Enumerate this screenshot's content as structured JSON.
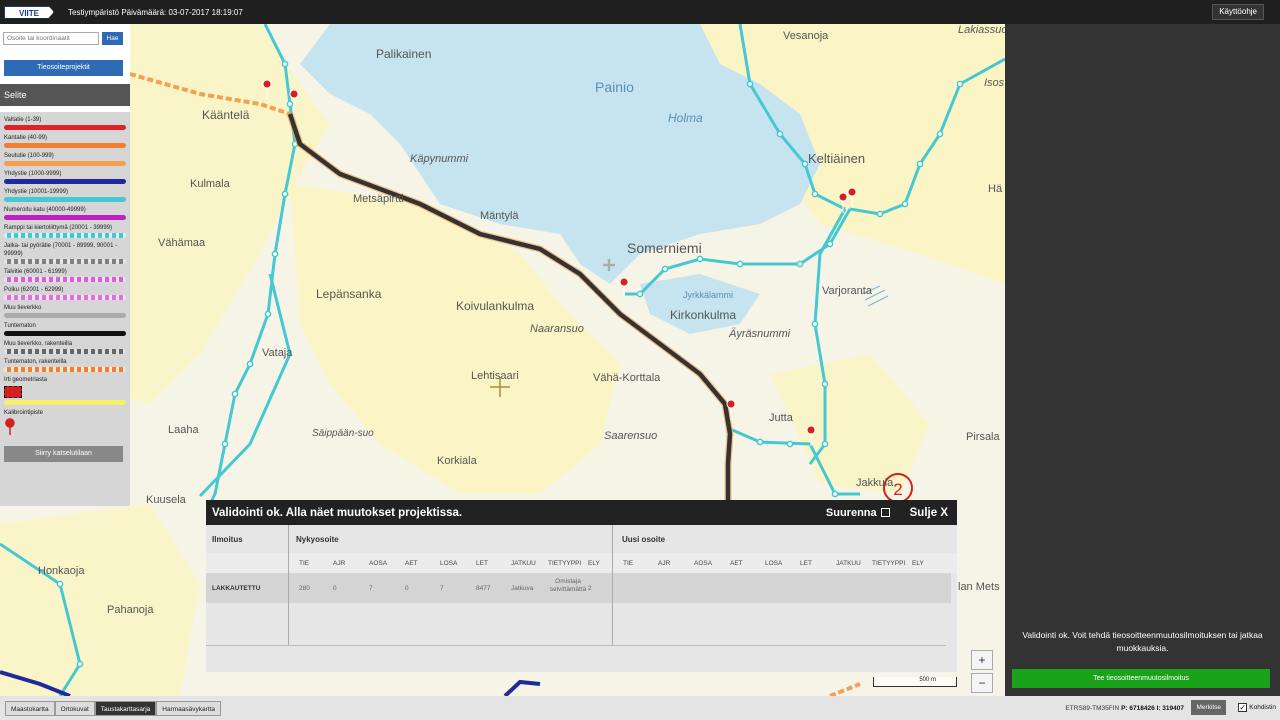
{
  "header": {
    "logo": "VIITE",
    "env": "Testiympäristö Päivämäärä: 03-07-2017 18:19:07",
    "help_label": "Käyttöohje"
  },
  "sidebar": {
    "search_placeholder": "Osoite tai koordinaatit",
    "search_button": "Hae",
    "project_button": "Tieosoiteprojektit",
    "legend_title": "Selite",
    "legend": [
      {
        "label": "Valtatie (1-39)",
        "color": "#e0202a"
      },
      {
        "label": "Kantatie (40-99)",
        "color": "#f08030"
      },
      {
        "label": "Seututie (100-999)",
        "color": "#f4a050"
      },
      {
        "label": "Yhdystie (1000-9999)",
        "color": "#202a9c"
      },
      {
        "label": "Yhdystie (10001-19999)",
        "color": "#45c8d2"
      },
      {
        "label": "Numeroitu katu (40000-49999)",
        "color": "#c020c8"
      },
      {
        "label": "Ramppi tai kiertoliittymä (20001 - 39999)",
        "color": "#45c8d2"
      },
      {
        "label": "Jalka- tai pyörätie (70001 - 89999, 90001 - 99999)",
        "color": "#808080"
      },
      {
        "label": "Talvitie (60001 - 61999)",
        "color": "#d860d8"
      },
      {
        "label": "Polku (62001 - 62999)",
        "color": "#e070e0"
      },
      {
        "label": "Muu tieverkko",
        "color": "#aaaaaa"
      },
      {
        "label": "Tuntematon",
        "color": "#111111"
      },
      {
        "label": "Muu tieverkko, rakenteilla",
        "color": "#666666"
      },
      {
        "label": "Tuntematon, rakenteilla",
        "color": "#f08030"
      }
    ],
    "detached_label": "Irti geometriasta",
    "calibration_label": "Kalibrointipiste",
    "return_button": "Siirry katselutilaan"
  },
  "map": {
    "places": [
      {
        "name": "Palikainen",
        "style": "town"
      },
      {
        "name": "Kääntelä",
        "style": "town"
      },
      {
        "name": "Kulmala",
        "style": "town"
      },
      {
        "name": "Vähämaa",
        "style": "town"
      },
      {
        "name": "Metsäpirtti",
        "style": "town"
      },
      {
        "name": "Käpynummi",
        "style": "italic"
      },
      {
        "name": "Mäntylä",
        "style": "town"
      },
      {
        "name": "Lepänsanka",
        "style": "town"
      },
      {
        "name": "Vataja",
        "style": "town"
      },
      {
        "name": "Koivulankulma",
        "style": "town"
      },
      {
        "name": "Naaransuo",
        "style": "italic"
      },
      {
        "name": "Lehtisaari",
        "style": "town"
      },
      {
        "name": "Vähä-Korttala",
        "style": "town"
      },
      {
        "name": "Laaha",
        "style": "town"
      },
      {
        "name": "Säippään-suo",
        "style": "italic"
      },
      {
        "name": "Korkiala",
        "style": "town"
      },
      {
        "name": "Kuusela",
        "style": "town"
      },
      {
        "name": "Honkaoja",
        "style": "town"
      },
      {
        "name": "Pahanoja",
        "style": "town"
      },
      {
        "name": "Painio",
        "style": "water"
      },
      {
        "name": "Holma",
        "style": "water-italic"
      },
      {
        "name": "Somerniemi",
        "style": "bigtown"
      },
      {
        "name": "Jyrkkälammi",
        "style": "water-small"
      },
      {
        "name": "Kirkonkulma",
        "style": "town"
      },
      {
        "name": "Äyräsnummi",
        "style": "italic"
      },
      {
        "name": "Saarensuo",
        "style": "italic"
      },
      {
        "name": "Varjoranta",
        "style": "town"
      },
      {
        "name": "Jutta",
        "style": "town"
      },
      {
        "name": "Keltiäinen",
        "style": "bigtown"
      },
      {
        "name": "Vesanoja",
        "style": "town"
      },
      {
        "name": "Lakiassuo",
        "style": "italic"
      },
      {
        "name": "Isos",
        "style": "italic"
      },
      {
        "name": "Hä",
        "style": "town"
      },
      {
        "name": "Pirsala",
        "style": "town"
      },
      {
        "name": "Jakkula",
        "style": "town"
      },
      {
        "name": "lan Mets",
        "style": "town"
      }
    ],
    "marker_number": "2",
    "scale_label": "500 m",
    "zoom_in": "+",
    "zoom_out": "−"
  },
  "popup": {
    "title": "Validointi ok. Alla näet muutokset projektissa.",
    "enlarge_label": "Suurenna",
    "close_label": "Sulje X",
    "col_notice": "Ilmoitus",
    "col_current": "Nykyosoite",
    "col_new": "Uusi osoite",
    "headers": [
      "TIE",
      "AJR",
      "AOSA",
      "AET",
      "LOSA",
      "LET",
      "JATKUU",
      "TIETYYPPI",
      "ELY"
    ],
    "row": {
      "notice": "LAKKAUTETTU",
      "values": [
        "280",
        "0",
        "7",
        "0",
        "7",
        "8477",
        "Jatkuva",
        "Omistaja selvittämättä",
        "2"
      ]
    }
  },
  "right_panel": {
    "message": "Validointi ok. Voit tehdä tieosoitteenmuutosilmoituksen tai jatkaa muokkauksia.",
    "notify_button": "Tee tieosoitteenmuutosilmoitus"
  },
  "bottom": {
    "tabs": [
      {
        "label": "Maastokartta",
        "active": false
      },
      {
        "label": "Ortokuvat",
        "active": false
      },
      {
        "label": "Taustakarttasarja",
        "active": true
      },
      {
        "label": "Harmaasävykartta",
        "active": false
      }
    ],
    "crs": "ETRS89-TM35FIN",
    "p_label": "P:",
    "p_value": "6718426",
    "i_label": "I:",
    "i_value": "319407",
    "mark_button": "Merkitse",
    "crosshair_label": "Kohdistin",
    "crosshair_checked": "✓"
  }
}
